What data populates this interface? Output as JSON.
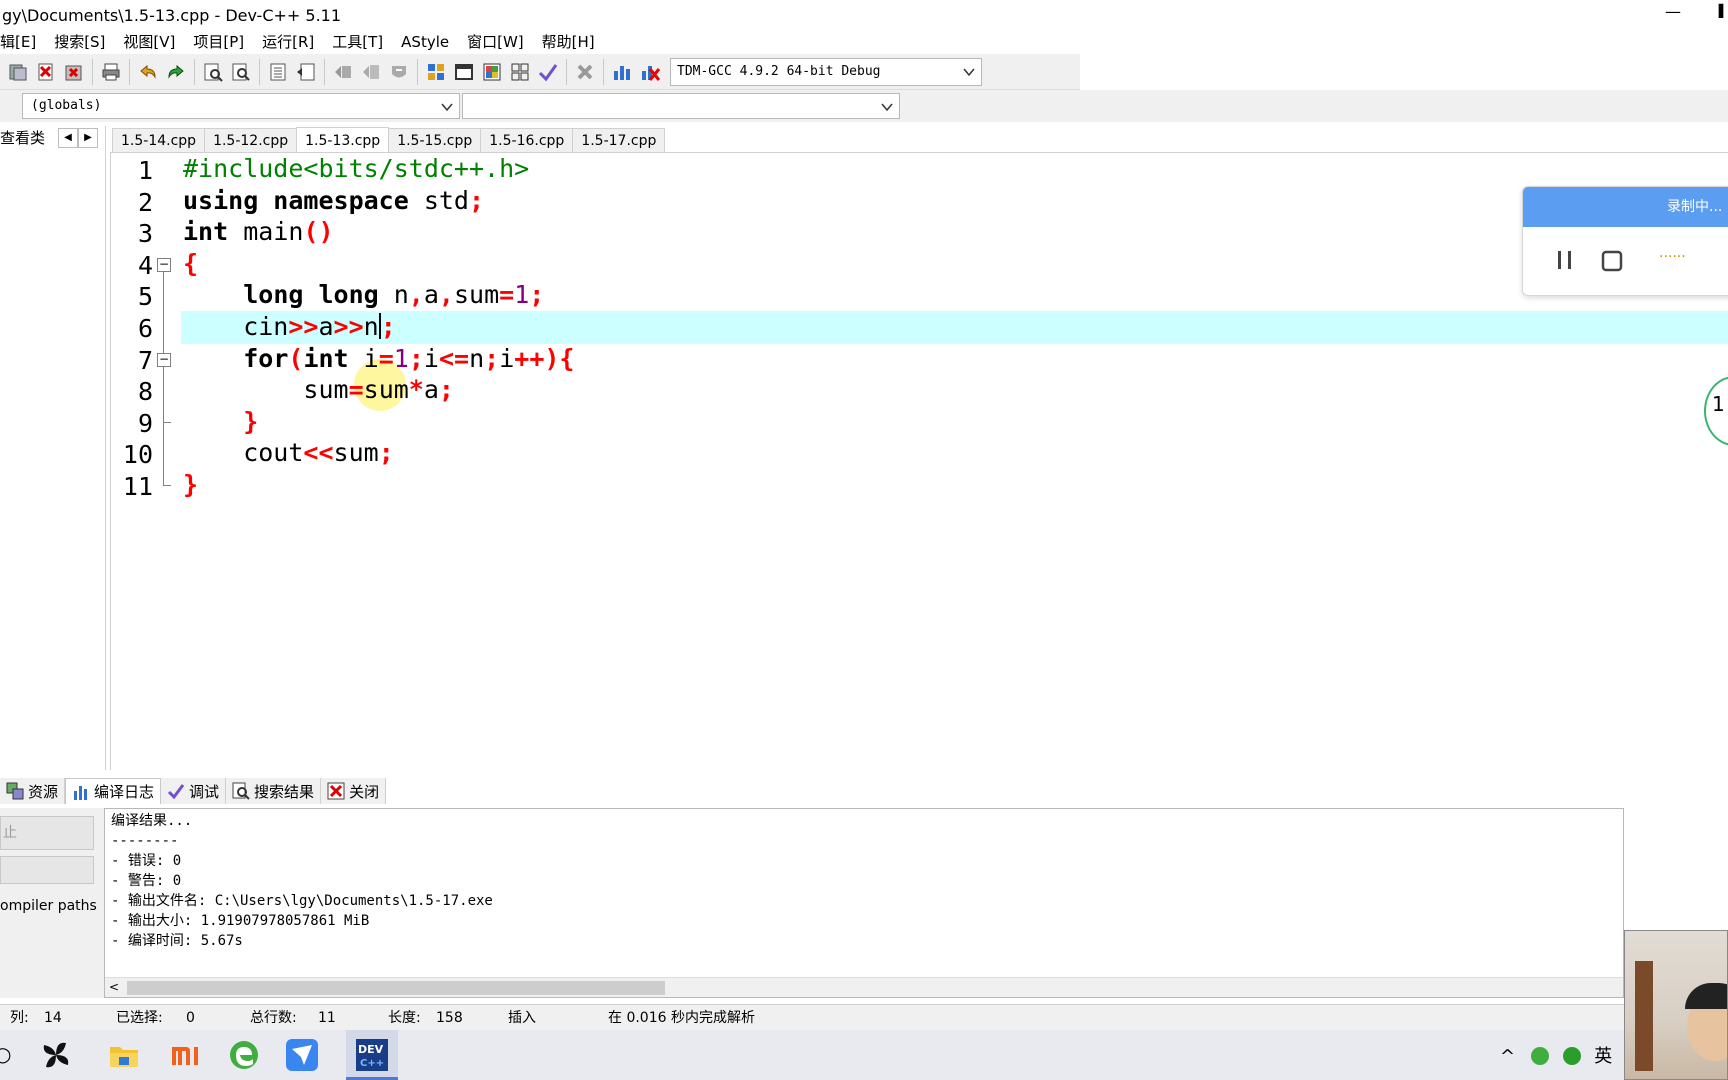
{
  "window": {
    "title": "gy\\Documents\\1.5-13.cpp - Dev-C++ 5.11",
    "minimize_glyph": "—",
    "edge_glyph": "▌"
  },
  "menu": [
    "辑[E]",
    "搜索[S]",
    "视图[V]",
    "项目[P]",
    "运行[R]",
    "工具[T]",
    "AStyle",
    "窗口[W]",
    "帮助[H]"
  ],
  "toolbar": {
    "compiler_select": "TDM-GCC 4.9.2 64-bit Debug",
    "icons": [
      "close-file-icon",
      "close-all-icon",
      "close-project-icon",
      "print-icon",
      "undo-icon",
      "redo-icon",
      "find-icon",
      "replace-icon",
      "indent-icon",
      "unindent-icon",
      "bookmark-prev-icon",
      "bookmark-next-icon",
      "goto-icon",
      "compile-icon",
      "run-icon",
      "compile-run-icon",
      "rebuild-icon",
      "check-syntax-icon",
      "stop-icon",
      "profile-icon",
      "delete-profile-icon"
    ]
  },
  "combos": {
    "scope": "(globals)",
    "member": ""
  },
  "left_panel": {
    "class_tab": "查看类",
    "prev_glyph": "◀",
    "next_glyph": "▶"
  },
  "tabs": [
    {
      "label": "1.5-14.cpp",
      "active": false
    },
    {
      "label": "1.5-12.cpp",
      "active": false
    },
    {
      "label": "1.5-13.cpp",
      "active": true
    },
    {
      "label": "1.5-15.cpp",
      "active": false
    },
    {
      "label": "1.5-16.cpp",
      "active": false
    },
    {
      "label": "1.5-17.cpp",
      "active": false
    }
  ],
  "editor": {
    "line_numbers": [
      "1",
      "2",
      "3",
      "4",
      "5",
      "6",
      "7",
      "8",
      "9",
      "10",
      "11"
    ],
    "fold_open_glyph": "−",
    "current_line": 6,
    "lines": [
      [
        [
          "pp",
          "#include<bits/stdc++.h>"
        ]
      ],
      [
        [
          "kw",
          "using namespace "
        ],
        [
          "id",
          "std"
        ],
        [
          "op",
          ";"
        ]
      ],
      [
        [
          "kw",
          "int "
        ],
        [
          "id",
          "main"
        ],
        [
          "op",
          "()"
        ]
      ],
      [
        [
          "op",
          "{"
        ]
      ],
      [
        [
          "id",
          "    "
        ],
        [
          "kw",
          "long long "
        ],
        [
          "id",
          "n"
        ],
        [
          "op",
          ","
        ],
        [
          "id",
          "a"
        ],
        [
          "op",
          ","
        ],
        [
          "id",
          "sum"
        ],
        [
          "op",
          "="
        ],
        [
          "num",
          "1"
        ],
        [
          "op",
          ";"
        ]
      ],
      [
        [
          "id",
          "    cin"
        ],
        [
          "op",
          ">>"
        ],
        [
          "id",
          "a"
        ],
        [
          "op",
          ">>"
        ],
        [
          "id",
          "n"
        ],
        [
          "caret",
          ""
        ],
        [
          "op",
          ";"
        ]
      ],
      [
        [
          "id",
          "    "
        ],
        [
          "kw",
          "for"
        ],
        [
          "op",
          "("
        ],
        [
          "kw",
          "int "
        ],
        [
          "id",
          "i"
        ],
        [
          "op",
          "="
        ],
        [
          "num",
          "1"
        ],
        [
          "op",
          ";"
        ],
        [
          "id",
          "i"
        ],
        [
          "op",
          "<="
        ],
        [
          "id",
          "n"
        ],
        [
          "op",
          ";"
        ],
        [
          "id",
          "i"
        ],
        [
          "op",
          "++){"
        ]
      ],
      [
        [
          "id",
          "        sum"
        ],
        [
          "op",
          "="
        ],
        [
          "id",
          "sum"
        ],
        [
          "op",
          "*"
        ],
        [
          "id",
          "a"
        ],
        [
          "op",
          ";"
        ]
      ],
      [
        [
          "id",
          "    "
        ],
        [
          "op",
          "}"
        ]
      ],
      [
        [
          "id",
          "    cout"
        ],
        [
          "op",
          "<<"
        ],
        [
          "id",
          "sum"
        ],
        [
          "op",
          ";"
        ]
      ],
      [
        [
          "op",
          "}"
        ]
      ]
    ]
  },
  "recording": {
    "status": "录制中...",
    "dots": "......",
    "side_label": "1"
  },
  "bottom_tabs": [
    {
      "label": "资源",
      "icon": "resource-icon",
      "active": false
    },
    {
      "label": "编译日志",
      "icon": "compile-log-icon",
      "active": true
    },
    {
      "label": "调试",
      "icon": "debug-icon",
      "active": false
    },
    {
      "label": "搜索结果",
      "icon": "search-results-icon",
      "active": false
    },
    {
      "label": "关闭",
      "icon": "close-icon",
      "active": false
    }
  ],
  "bottom_left": {
    "abort_button": "止",
    "blank_button": "",
    "compiler_paths": "ompiler paths"
  },
  "compile_log": [
    "编译结果...",
    "--------",
    "- 错误: 0",
    "- 警告: 0",
    "- 输出文件名: C:\\Users\\lgy\\Documents\\1.5-17.exe",
    "- 输出大小: 1.91907978057861 MiB",
    "- 编译时间: 5.67s"
  ],
  "scroll_left_glyph": "<",
  "status": {
    "col_label": "列:",
    "col_value": "14",
    "selected_label": "已选择:",
    "selected_value": "0",
    "lines_label": "总行数:",
    "lines_value": "11",
    "length_label": "长度:",
    "length_value": "158",
    "mode": "插入",
    "parse": "在 0.016 秒内完成解析"
  },
  "taskbar": {
    "left_glyph": "○",
    "apps": [
      "pinwheel-app-icon",
      "file-explorer-icon",
      "mi-app-icon",
      "edge-browser-icon",
      "feishu-app-icon",
      "dev-cpp-icon"
    ],
    "tray": {
      "chevron": "^",
      "ime": "英"
    }
  },
  "colors": {
    "keyword": "#000000",
    "preprocessor": "#008000",
    "operator": "#ff0000",
    "number": "#800080",
    "current_line": "#ccffff",
    "recording_header": "#5b9df0"
  }
}
